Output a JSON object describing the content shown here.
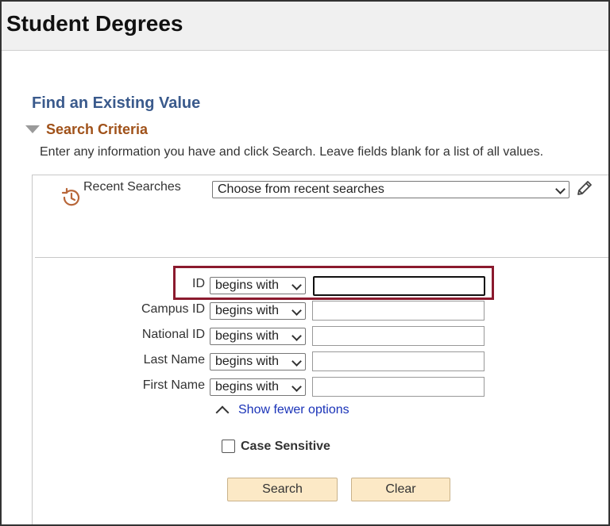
{
  "header": {
    "title": "Student Degrees"
  },
  "main": {
    "find_title": "Find an Existing Value",
    "criteria_title": "Search Criteria",
    "instructions": "Enter any information you have and click Search. Leave fields blank for a list of all values."
  },
  "recent": {
    "label": "Recent Searches",
    "select_value": "Choose from recent searches"
  },
  "fields": [
    {
      "label": "ID",
      "operator": "begins with",
      "value": ""
    },
    {
      "label": "Campus ID",
      "operator": "begins with",
      "value": ""
    },
    {
      "label": "National ID",
      "operator": "begins with",
      "value": ""
    },
    {
      "label": "Last Name",
      "operator": "begins with",
      "value": ""
    },
    {
      "label": "First Name",
      "operator": "begins with",
      "value": ""
    }
  ],
  "options": {
    "fewer_label": "Show fewer options",
    "case_label": "Case Sensitive",
    "case_checked": false
  },
  "buttons": {
    "search": "Search",
    "clear": "Clear"
  },
  "colors": {
    "title_blue": "#3a5a8c",
    "criteria_orange": "#a0521a",
    "highlight": "#8b1a2e",
    "link_blue": "#1a33b8",
    "button_bg": "#fce9c6"
  },
  "icons": {
    "recent": "history-icon",
    "edit": "pencil-icon",
    "collapse": "triangle-down-icon",
    "fewer": "chevron-up-icon",
    "select": "chevron-down-icon"
  }
}
